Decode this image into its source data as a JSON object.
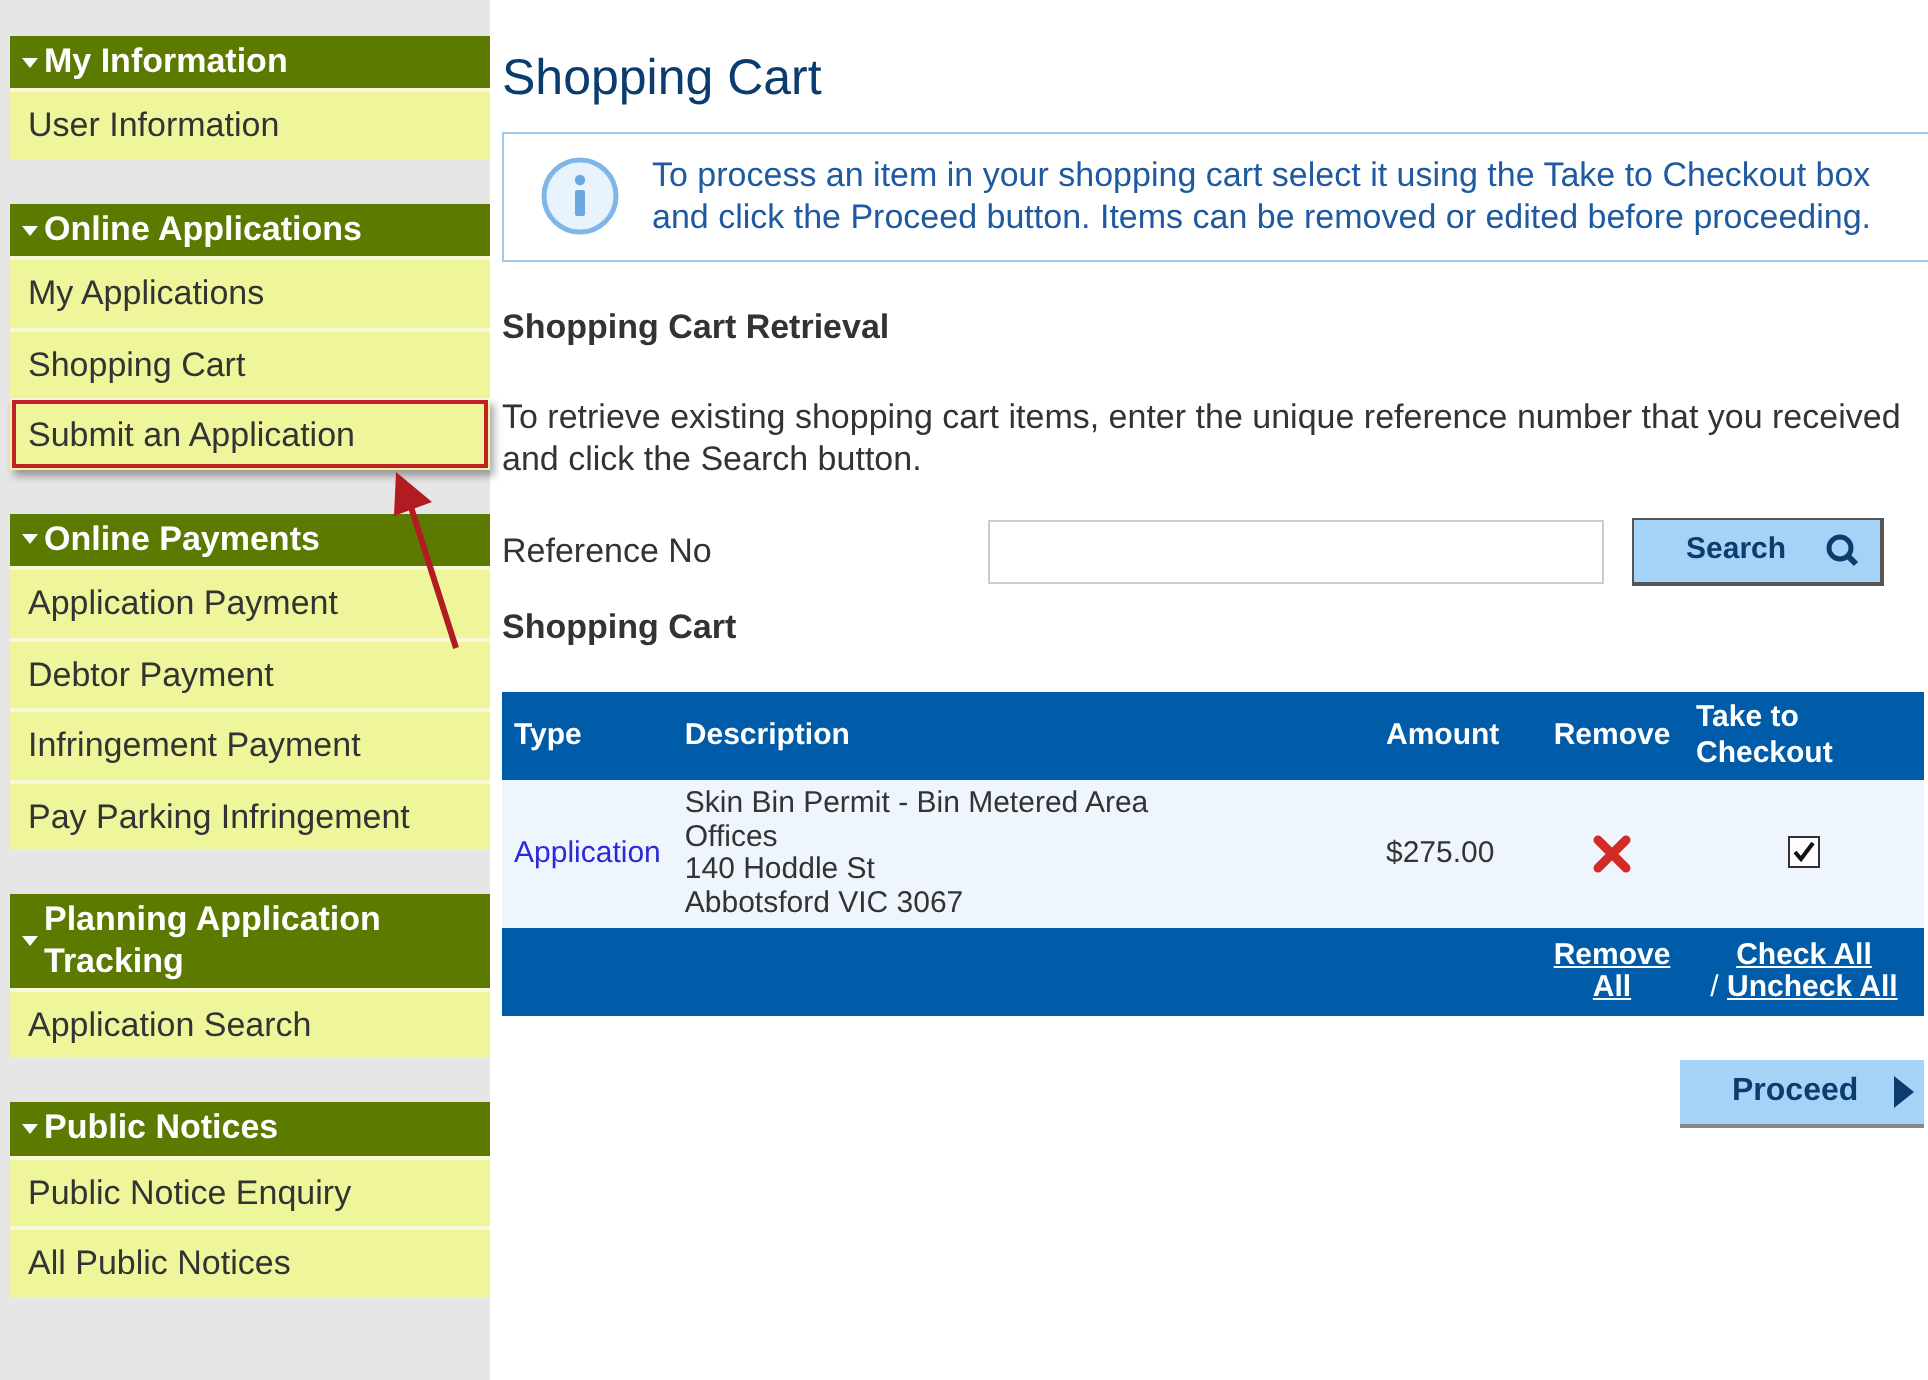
{
  "sidebar": {
    "sections": [
      {
        "title": "My Information",
        "expanded": true,
        "items": [
          {
            "label": "User Information",
            "highlighted": false
          }
        ]
      },
      {
        "title": "Online Applications",
        "expanded": true,
        "items": [
          {
            "label": "My Applications",
            "highlighted": false
          },
          {
            "label": "Shopping Cart",
            "highlighted": false
          },
          {
            "label": "Submit an Application",
            "highlighted": true
          }
        ]
      },
      {
        "title": "Online Payments",
        "expanded": true,
        "items": [
          {
            "label": "Application Payment",
            "highlighted": false
          },
          {
            "label": "Debtor Payment",
            "highlighted": false
          },
          {
            "label": "Infringement Payment",
            "highlighted": false
          },
          {
            "label": "Pay Parking Infringement",
            "highlighted": false
          }
        ]
      },
      {
        "title": "Planning Application Tracking",
        "expanded": true,
        "items": [
          {
            "label": "Application Search",
            "highlighted": false
          }
        ]
      },
      {
        "title": "Public Notices",
        "expanded": true,
        "items": [
          {
            "label": "Public Notice Enquiry",
            "highlighted": false
          },
          {
            "label": "All Public Notices",
            "highlighted": false
          }
        ]
      }
    ]
  },
  "page_title": "Shopping Cart",
  "info_message": "To process an item in your shopping cart select it using the Take to Checkout box and click the Proceed button. Items can be removed or edited before proceeding.",
  "retrieval": {
    "heading": "Shopping Cart Retrieval",
    "instructions": "To retrieve existing shopping cart items, enter the unique reference number that you received and click the Search button.",
    "field_label": "Reference No",
    "search_button": "Search"
  },
  "cart": {
    "heading": "Shopping Cart",
    "columns": [
      "Type",
      "Description",
      "Amount",
      "Remove",
      "Take to Checkout"
    ],
    "rows": [
      {
        "type": "Application",
        "description": [
          "Skin Bin Permit - Bin Metered Area Offices",
          "140 Hoddle St",
          "Abbotsford VIC 3067"
        ],
        "amount": "$275.00",
        "checked": true
      }
    ],
    "footer": {
      "remove_all": "Remove All",
      "separator": "/",
      "check_all": "Check All",
      "uncheck_all": "Uncheck All"
    }
  },
  "proceed_button": "Proceed"
}
